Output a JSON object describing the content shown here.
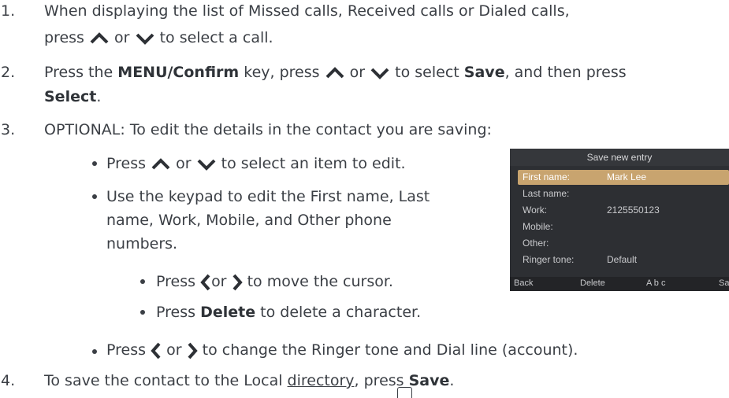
{
  "steps": [
    {
      "num": "1.",
      "line1": "When displaying the list of Missed calls, Received calls or Dialed calls,",
      "line2_pre": "press",
      "line2_or": "or",
      "line2_post": "to select a call."
    },
    {
      "num": "2.",
      "pre": "Press the",
      "key": "MENU/Confirm",
      "mid1": "key, press",
      "or": "or",
      "mid2": "to select",
      "save": "Save",
      "post": ", and then press",
      "select": "Select",
      "dot": "."
    },
    {
      "num": "3.",
      "text": "OPTIONAL: To edit the details in the contact you are saving:",
      "bullets": {
        "b1_pre": "Press",
        "b1_or": "or",
        "b1_post": "to select an item to edit.",
        "b2_l1": "Use the keypad to edit the First name, Last",
        "b2_l2": "name, Work, Mobile, and Other phone",
        "b2_l3": "numbers.",
        "sub1_pre": "Press",
        "sub1_or": "or",
        "sub1_post": "to move the cursor.",
        "sub2_pre": "Press",
        "sub2_key": "Delete",
        "sub2_post": "to delete a character.",
        "b3_pre": "Press",
        "b3_or": "or",
        "b3_post": "to change the Ringer tone and Dial line (account)."
      }
    },
    {
      "num": "4.",
      "pre": "To save the contact to the Local",
      "dir": "directory",
      "mid": ", press",
      "save": "Save",
      "dot": "."
    }
  ],
  "screen": {
    "title": "Save new entry",
    "rows": [
      {
        "label": "First name:",
        "value": "Mark Lee",
        "selected": true
      },
      {
        "label": "Last name:",
        "value": ""
      },
      {
        "label": "Work:",
        "value": "2125550123"
      },
      {
        "label": "Mobile:",
        "value": ""
      },
      {
        "label": "Other:",
        "value": ""
      },
      {
        "label": "Ringer tone:",
        "value": "Default"
      }
    ],
    "softkeys": [
      "Back",
      "Delete",
      "A b c",
      "Sa"
    ]
  },
  "icons": [
    "up-arrow-icon",
    "down-arrow-icon",
    "left-arrow-icon",
    "right-arrow-icon"
  ]
}
